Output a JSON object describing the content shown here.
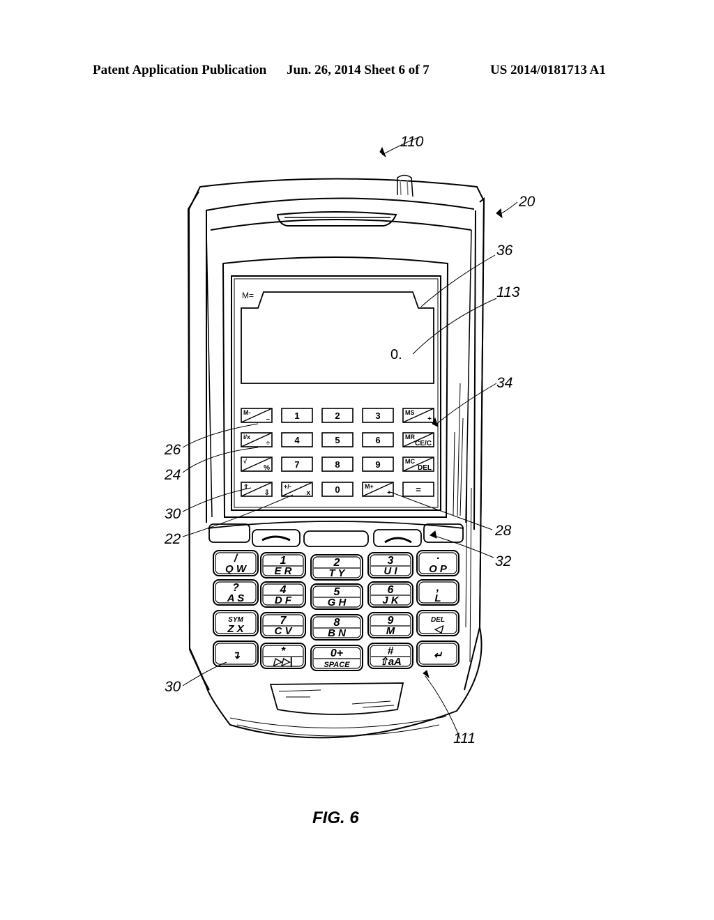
{
  "header": {
    "publication": "Patent Application Publication",
    "date_sheet": "Jun. 26, 2014  Sheet 6 of 7",
    "patent_number": "US 2014/0181713 A1"
  },
  "figure": {
    "caption": "FIG. 6",
    "reference_numerals": {
      "device": "110",
      "housing": "20",
      "display_window": "36",
      "display_value": "113",
      "calc_keypad": "34",
      "memory_minus_key": "26",
      "inverse_divide_key": "24",
      "scroll_key": "30",
      "plus_minus_key": "22",
      "memory_plus_key": "28",
      "side_key": "32",
      "scroll_key_lower": "30",
      "keyboard": "111"
    },
    "display": {
      "memory_label": "M=",
      "value": "0."
    },
    "calculator_keys": [
      [
        {
          "top": "M-",
          "bottom": "–",
          "split": true
        },
        {
          "label": "1"
        },
        {
          "label": "2"
        },
        {
          "label": "3"
        },
        {
          "top": "MS",
          "bottom": "+",
          "split": true
        }
      ],
      [
        {
          "top": "i/x",
          "bottom": "÷",
          "split": true
        },
        {
          "label": "4"
        },
        {
          "label": "5"
        },
        {
          "label": "6"
        },
        {
          "top": "MR",
          "bottom": "CE/C",
          "split": true
        }
      ],
      [
        {
          "top": "√",
          "bottom": "%",
          "split": true
        },
        {
          "label": "7"
        },
        {
          "label": "8"
        },
        {
          "label": "9"
        },
        {
          "top": "MC",
          "bottom": "DEL",
          "split": true
        }
      ],
      [
        {
          "top": "⇧",
          "bottom": "⇩",
          "split": true
        },
        {
          "top": "+/-",
          "bottom": "x",
          "split": true
        },
        {
          "label": "0"
        },
        {
          "top": "M+",
          "bottom": "+",
          "split": true
        },
        {
          "label": "="
        }
      ]
    ],
    "call_row": {
      "send_icon": "phone-answer-icon",
      "end_icon": "phone-hangup-icon"
    },
    "keyboard_keys": [
      [
        {
          "top": "/",
          "bottom": "Q W"
        },
        {
          "top": "1",
          "bottom": "E R"
        },
        {
          "top": "2",
          "bottom": "T Y"
        },
        {
          "top": "3",
          "bottom": "U I"
        },
        {
          "top": "·",
          "bottom": "O P"
        }
      ],
      [
        {
          "top": "?",
          "bottom": "A S"
        },
        {
          "top": "4",
          "bottom": "D F"
        },
        {
          "top": "5",
          "bottom": "G H"
        },
        {
          "top": "6",
          "bottom": "J K"
        },
        {
          "top": ",",
          "bottom": "L"
        }
      ],
      [
        {
          "top": "SYM",
          "bottom": "Z X"
        },
        {
          "top": "7",
          "bottom": "C V"
        },
        {
          "top": "8",
          "bottom": "B N"
        },
        {
          "top": "9",
          "bottom": "M"
        },
        {
          "top": "DEL",
          "bottom": "◁"
        }
      ],
      [
        {
          "top": "",
          "bottom": "↴"
        },
        {
          "top": "*",
          "bottom": "▷▷|"
        },
        {
          "top": "0+",
          "bottom": "SPACE"
        },
        {
          "top": "#",
          "bottom": "⇧aA"
        },
        {
          "top": "",
          "bottom": "↵"
        }
      ]
    ]
  }
}
